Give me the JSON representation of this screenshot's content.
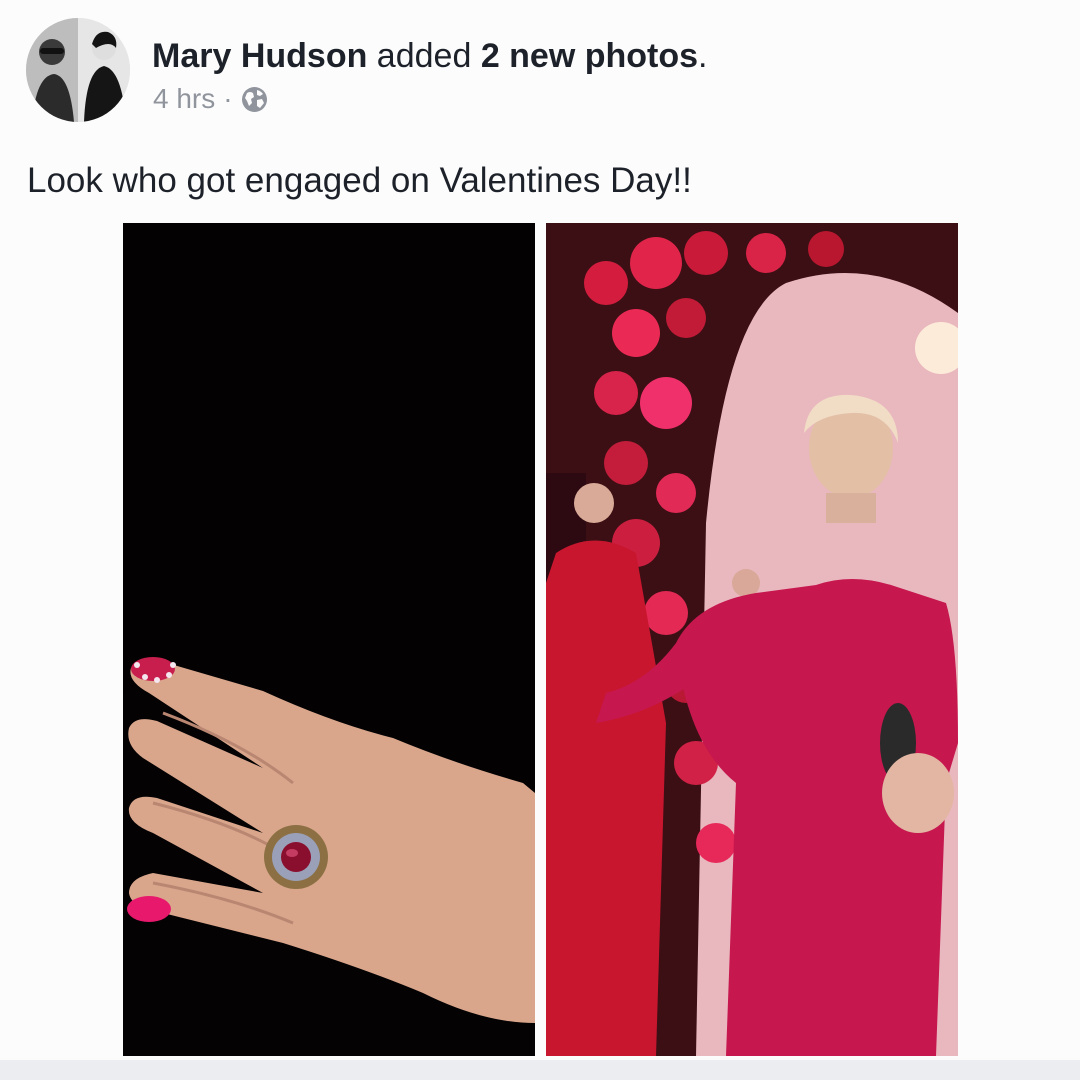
{
  "post": {
    "author_name": "Mary Hudson",
    "action_verb": " added ",
    "action_target": "2 new photos",
    "action_end": ".",
    "timestamp": "4 hrs",
    "separator": "·",
    "privacy_icon": "globe-icon",
    "caption": "Look who got engaged on Valentines Day!!"
  },
  "photos": [
    {
      "icon": "photo-ring-hand"
    },
    {
      "icon": "photo-party-roses"
    }
  ],
  "colors": {
    "text_primary": "#1d2129",
    "text_secondary": "#90949c",
    "background": "#fcfcfc"
  }
}
